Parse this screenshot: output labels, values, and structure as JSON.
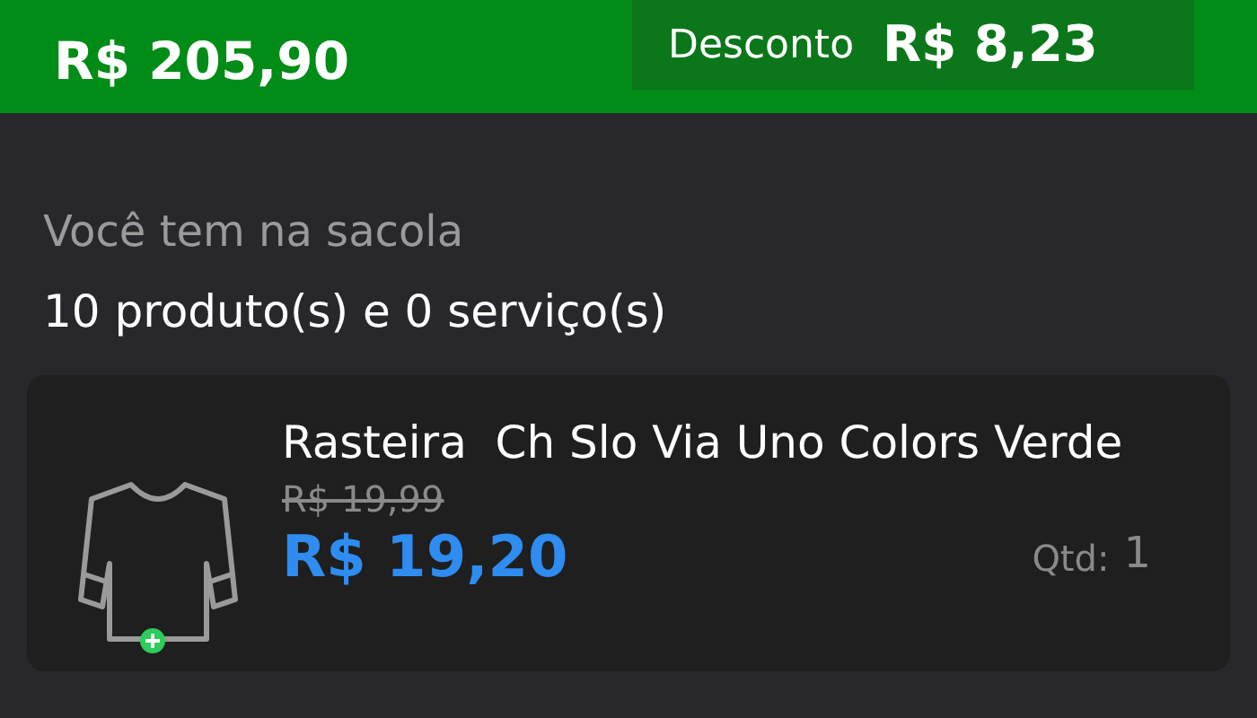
{
  "header": {
    "total": "R$ 205,90",
    "discount_label": "Desconto",
    "discount_value": "R$ 8,23"
  },
  "bag": {
    "label": "Você tem na sacola",
    "summary": "10 produto(s) e 0 serviço(s)"
  },
  "items": [
    {
      "name": "Rasteira  Ch Slo Via Uno Colors Verde",
      "old_price": "R$ 19,99",
      "price": "R$ 19,20",
      "qty_label": "Qtd:",
      "qty": "1"
    }
  ]
}
